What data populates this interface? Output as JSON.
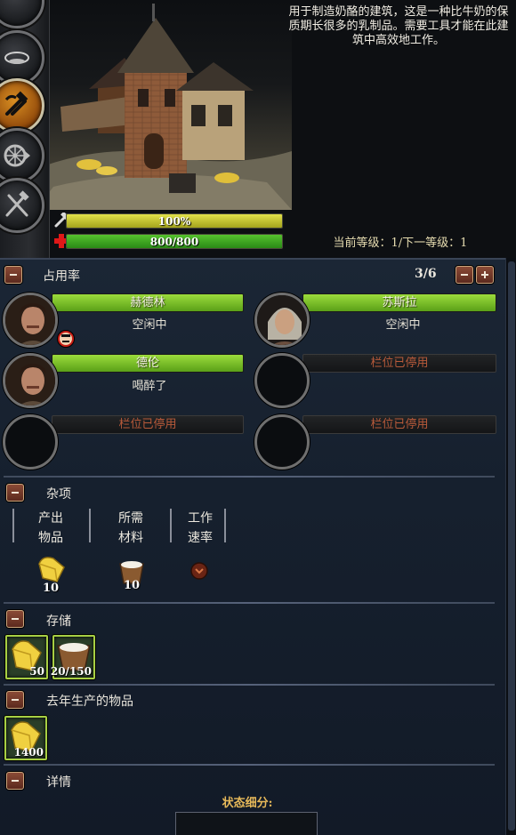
{
  "building": {
    "description": "用于制造奶酪的建筑，这是一种比牛奶的保质期长很多的乳制品。需要工具才能在此建筑中高效地工作。",
    "condition_percent": "100%",
    "condition_value": 1.0,
    "health": "800/800",
    "health_value": 1.0,
    "level_text": "当前等级：1/下一等级：1"
  },
  "sidebar": {
    "buttons": [
      {
        "icon": "storage-icon"
      },
      {
        "icon": "hammer-pick-icon",
        "active": true
      },
      {
        "icon": "cart-wheel-icon"
      },
      {
        "icon": "crossed-tools-icon"
      }
    ]
  },
  "occupancy": {
    "title": "占用率",
    "count": "3/6",
    "workers": [
      {
        "name": "赫德林",
        "status": "空闲中",
        "badge": "angry-face-icon"
      },
      {
        "name": "苏斯拉",
        "status": "空闲中"
      },
      {
        "name": "德伦",
        "status": "喝醉了"
      },
      {
        "name": "栏位已停用"
      },
      {
        "name": "栏位已停用"
      },
      {
        "name": "栏位已停用"
      }
    ]
  },
  "misc": {
    "title": "杂项",
    "columns": [
      {
        "line1": "产出",
        "line2": "物品",
        "value": "10",
        "icon": "cheese-icon"
      },
      {
        "line1": "所需",
        "line2": "材料",
        "value": "10",
        "icon": "milk-bucket-icon"
      },
      {
        "line1": "工作",
        "line2": "速率",
        "icon": "rate-down-icon"
      }
    ]
  },
  "storage": {
    "title": "存储",
    "items": [
      {
        "icon": "cheese-icon",
        "amount": "50"
      },
      {
        "icon": "milk-bucket-icon",
        "amount": "20/150"
      }
    ]
  },
  "last_year": {
    "title": "去年生产的物品",
    "items": [
      {
        "icon": "cheese-icon",
        "amount": "1400"
      }
    ]
  },
  "details": {
    "title": "详情",
    "breakdown_label": "状态细分:"
  },
  "colors": {
    "condition_bar": "#c8c832",
    "health_bar": "#3ea224",
    "active_worker": "#7cc02a",
    "disabled_slot_text": "#b85a3a"
  }
}
